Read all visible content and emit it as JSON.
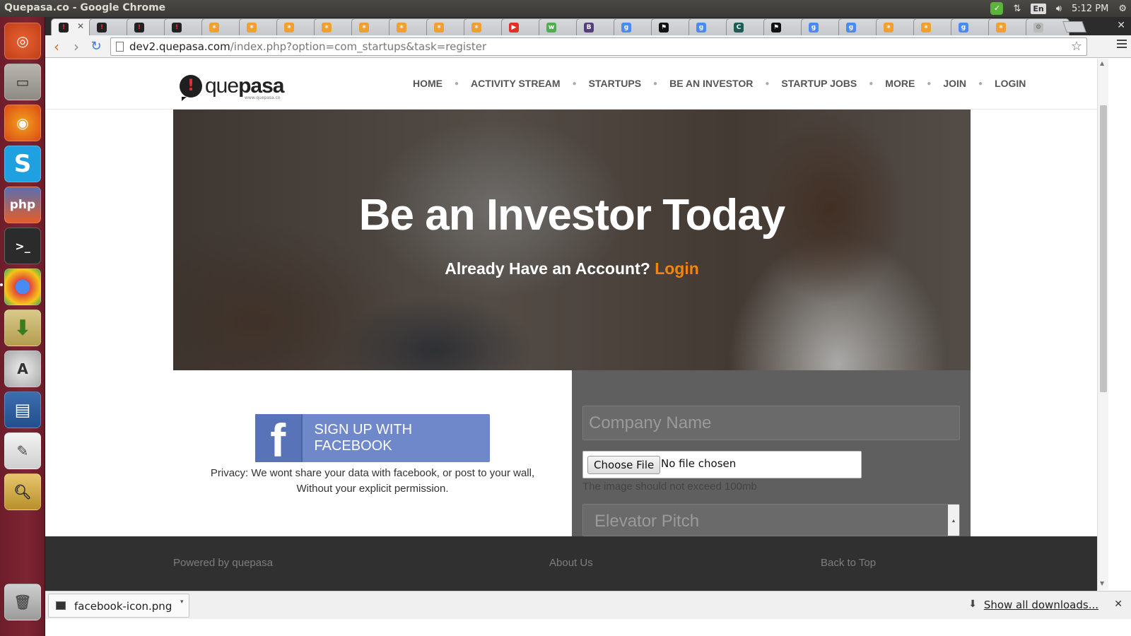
{
  "os": {
    "window_title": "Quepasa.co - Google Chrome",
    "clock": "5:12 PM",
    "lang": "En"
  },
  "browser": {
    "url_host": "dev2.quepasa.com",
    "url_path": "/index.php?option=com_startups&task=register"
  },
  "site": {
    "logo_word_light": "que",
    "logo_word_bold": "pasa",
    "logo_tag": "www.quepasa.co",
    "nav": [
      "HOME",
      "ACTIVITY STREAM",
      "STARTUPS",
      "BE AN INVESTOR",
      "STARTUP JOBS",
      "MORE",
      "JOIN",
      "LOGIN"
    ]
  },
  "hero": {
    "title": "Be an Investor Today",
    "subtitle": "Already Have an Account?",
    "login_link": "Login"
  },
  "signup": {
    "facebook_button": "SIGN UP WITH FACEBOOK",
    "privacy_line1": "Privacy: We wont share your data with facebook, or post to your wall,",
    "privacy_line2": "Without your explicit permission."
  },
  "form": {
    "company_placeholder": "Company Name",
    "choose_file_label": "Choose File",
    "no_file": "No file chosen",
    "file_hint": "The image should not exceed 100mb",
    "pitch_placeholder": "Elevator Pitch"
  },
  "footer": {
    "powered": "Powered by quepasa",
    "about": "About Us",
    "back_to_top": "Back to Top"
  },
  "downloads": {
    "file_name": "facebook-icon.png",
    "show_all": "Show all downloads..."
  },
  "colors": {
    "accent_orange": "#f0860f",
    "facebook_blue": "#6f88c9",
    "launcher": "#7e2533"
  }
}
